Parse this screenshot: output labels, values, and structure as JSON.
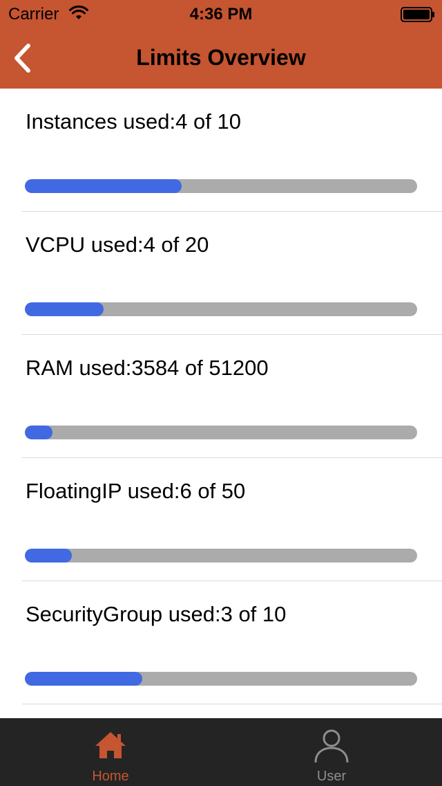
{
  "status_bar": {
    "carrier": "Carrier",
    "time": "4:36 PM"
  },
  "nav": {
    "back_icon": "chevron-left-icon",
    "title": "Limits Overview"
  },
  "limits": [
    {
      "label": "Instances used:4 of 10",
      "used": 4,
      "total": 10
    },
    {
      "label": "VCPU used:4 of 20",
      "used": 4,
      "total": 20
    },
    {
      "label": "RAM used:3584 of 51200",
      "used": 3584,
      "total": 51200
    },
    {
      "label": "FloatingIP used:6 of 50",
      "used": 6,
      "total": 50
    },
    {
      "label": "SecurityGroup used:3 of 10",
      "used": 3,
      "total": 10
    }
  ],
  "tab_bar": {
    "tabs": [
      {
        "label": "Home",
        "icon": "home-icon",
        "active": true
      },
      {
        "label": "User",
        "icon": "user-icon",
        "active": false
      }
    ]
  },
  "colors": {
    "header": "#c65531",
    "progress_fill": "#4169e1",
    "progress_track": "#ababab",
    "tab_bar": "#242424",
    "tab_active": "#c65531",
    "tab_inactive": "#8e8e8e"
  }
}
